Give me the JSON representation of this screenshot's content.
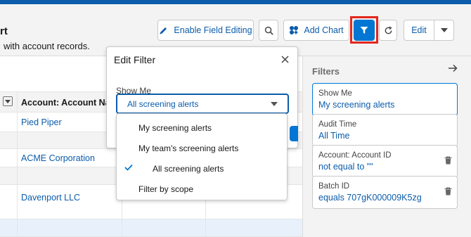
{
  "header": {
    "title_partial": "rt",
    "subtitle_partial": "with account records.",
    "buttons": {
      "enable_field_editing": "Enable Field Editing",
      "add_chart": "Add Chart",
      "edit": "Edit"
    }
  },
  "table": {
    "column_header": "Account: Account Name",
    "rows": [
      {
        "name": "Pied Piper"
      },
      {
        "name": ""
      },
      {
        "name": "ACME Corporation"
      },
      {
        "name": ""
      },
      {
        "name": "Davenport LLC"
      }
    ]
  },
  "popover": {
    "title": "Edit Filter",
    "show_me_label": "Show Me",
    "selected_value": "All screening alerts",
    "options": [
      {
        "label": "My screening alerts",
        "selected": false
      },
      {
        "label": "My team's screening alerts",
        "selected": false
      },
      {
        "label": "All screening alerts",
        "selected": true
      },
      {
        "label": "Filter by scope",
        "selected": false
      }
    ]
  },
  "filters_panel": {
    "title": "Filters",
    "cards": [
      {
        "label": "Show Me",
        "value": "My screening alerts",
        "active": true,
        "deletable": false
      },
      {
        "label": "Audit Time",
        "value": "All Time",
        "active": false,
        "deletable": false
      },
      {
        "label": "Account: Account ID",
        "value": "not equal to \"\"",
        "active": false,
        "deletable": true
      },
      {
        "label": "Batch ID",
        "value": "equals 707gK000009K5zg",
        "active": false,
        "deletable": true
      }
    ]
  },
  "colors": {
    "brand_blue": "#0176d3",
    "link_blue": "#0b5cab",
    "highlight_red": "#e3281e"
  }
}
